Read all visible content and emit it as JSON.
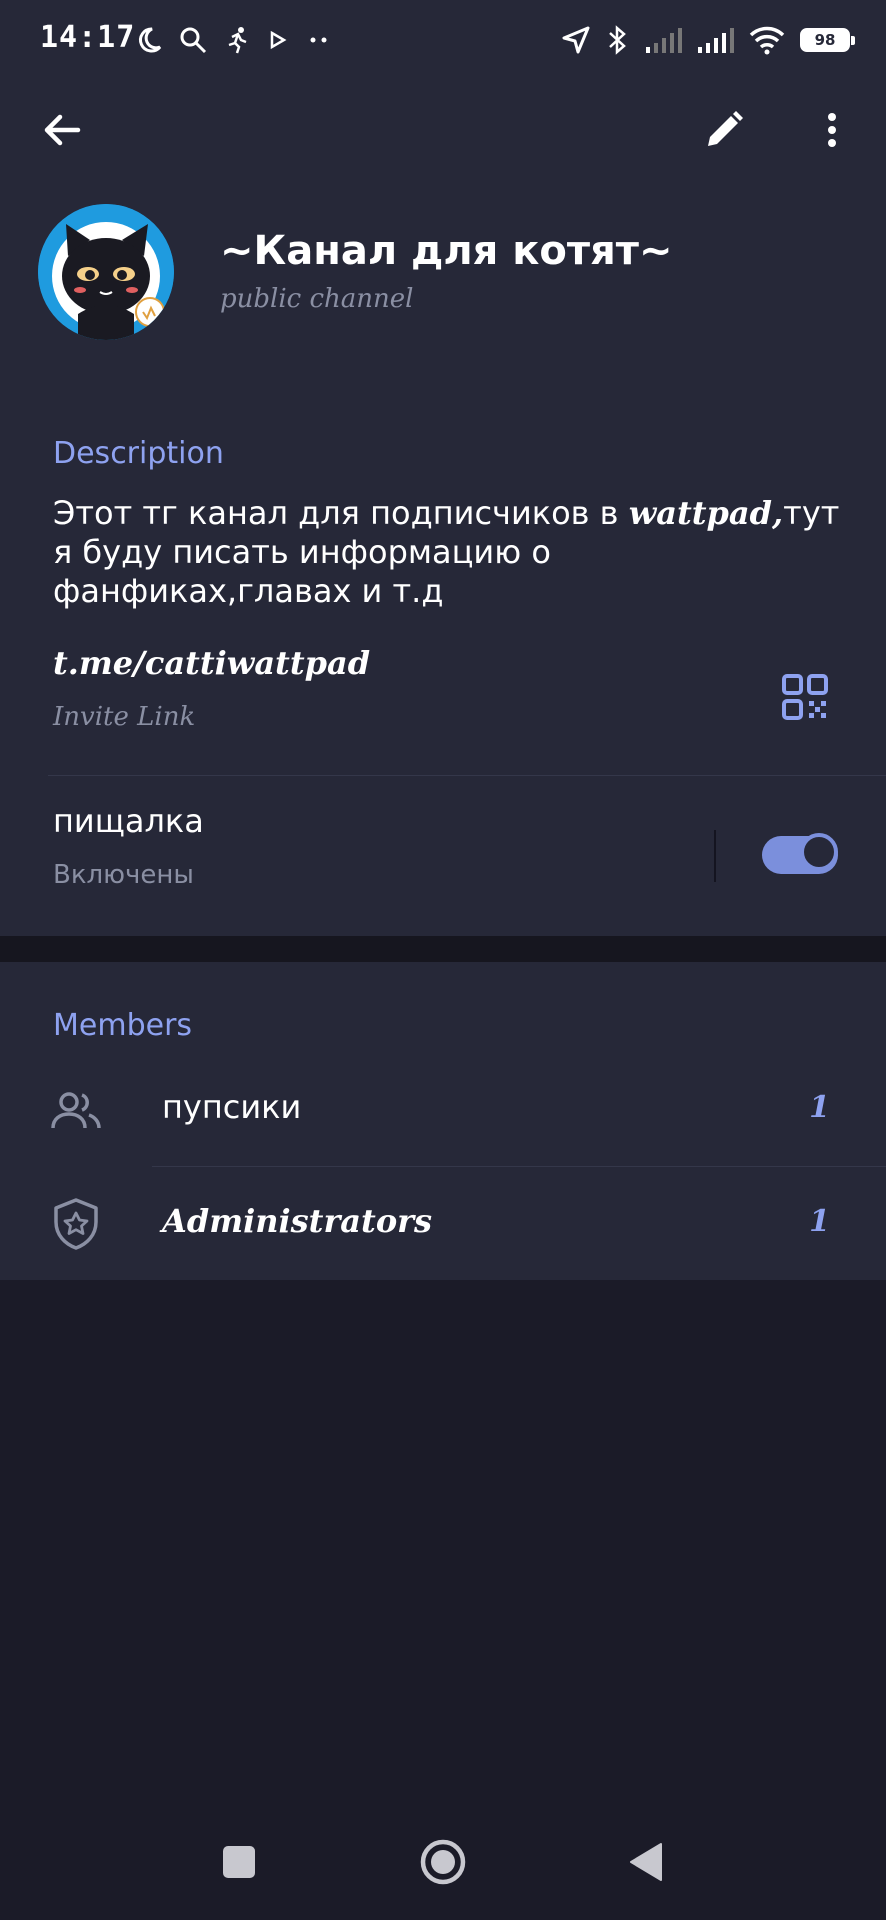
{
  "status_bar": {
    "time": "14:17",
    "left_icons": [
      "moon-icon",
      "search-icon",
      "running-icon",
      "play-icon",
      "more-dots-icon"
    ],
    "right_icons": [
      "location-icon",
      "bluetooth-icon",
      "signal-icon",
      "signal-icon",
      "wifi-icon"
    ],
    "battery": "98"
  },
  "header": {
    "title": "~Канал для котят~",
    "subtitle": "public channel"
  },
  "info": {
    "description_label": "Description",
    "description_part1": "Этот тг канал для подписчиков в ",
    "description_bold": "wattpad,",
    "description_part2": "тут я буду писать информацию о фанфиках,главах и т.д",
    "link": "t.me/cattiwattpad",
    "link_sub": "Invite Link",
    "notifications_title": "пищалка",
    "notifications_status": "Включены",
    "notifications_on": true
  },
  "members": {
    "label": "Members",
    "rows": [
      {
        "label": "пупсики",
        "count": "1",
        "icon": "members-icon"
      },
      {
        "label": "Administrators",
        "count": "1",
        "icon": "shield-star-icon"
      }
    ]
  },
  "colors": {
    "accent": "#8ea2f0",
    "card": "#262838",
    "background": "#1b1b28",
    "avatar_bg": "#1f9bdf"
  }
}
